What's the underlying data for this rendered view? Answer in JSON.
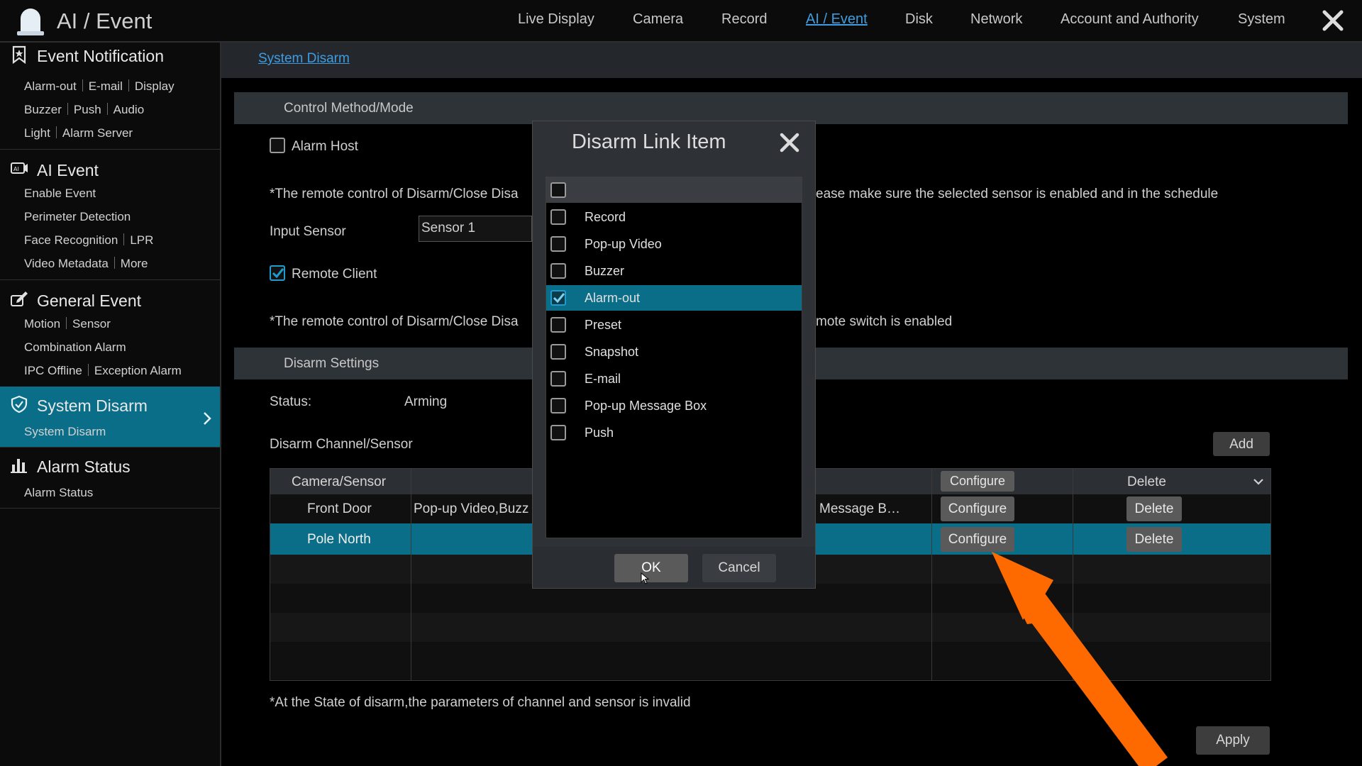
{
  "app": {
    "title": "AI / Event"
  },
  "nav": {
    "items": [
      "Live Display",
      "Camera",
      "Record",
      "AI / Event",
      "Disk",
      "Network",
      "Account and Authority",
      "System"
    ],
    "active": "AI / Event"
  },
  "sidebar": {
    "sections": [
      {
        "title": "Event Notification",
        "icon": "bookmark-star-icon",
        "rows": [
          [
            "Alarm-out",
            "E-mail",
            "Display"
          ],
          [
            "Buzzer",
            "Push",
            "Audio"
          ],
          [
            "Light",
            "Alarm Server"
          ]
        ]
      },
      {
        "title": "AI Event",
        "icon": "ai-camera-icon",
        "rows": [
          [
            "Enable Event"
          ],
          [
            "Perimeter Detection"
          ],
          [
            "Face Recognition",
            "LPR"
          ],
          [
            "Video Metadata",
            "More"
          ]
        ]
      },
      {
        "title": "General Event",
        "icon": "general-event-icon",
        "rows": [
          [
            "Motion",
            "Sensor"
          ],
          [
            "Combination Alarm"
          ],
          [
            "IPC Offline",
            "Exception Alarm"
          ]
        ]
      },
      {
        "title": "System Disarm",
        "icon": "shield-icon",
        "active": true,
        "rows": [
          [
            "System Disarm"
          ]
        ]
      },
      {
        "title": "Alarm Status",
        "icon": "bar-chart-icon",
        "rows": [
          [
            "Alarm Status"
          ]
        ]
      }
    ]
  },
  "page": {
    "breadcrumb": "System Disarm",
    "control_method": {
      "title": "Control Method/Mode",
      "alarm_host_label": "Alarm Host",
      "alarm_host_checked": false,
      "note1_left": "*The remote control of Disarm/Close Disa",
      "note1_right": "ease make sure the selected sensor is enabled and in the schedule",
      "input_sensor_label": "Input Sensor",
      "input_sensor_value": "Sensor 1",
      "remote_client_label": "Remote Client",
      "remote_client_checked": true,
      "note2_left": "*The remote control of Disarm/Close Disa",
      "note2_right": "mote switch is enabled"
    },
    "disarm_settings": {
      "title": "Disarm Settings",
      "status_label": "Status:",
      "status_value": "Arming",
      "channel_label": "Disarm Channel/Sensor",
      "add_label": "Add"
    },
    "table": {
      "headers": {
        "camera": "Camera/Sensor",
        "configure": "Configure",
        "delete": "Delete"
      },
      "rows": [
        {
          "name": "Front Door",
          "items_left": "Pop-up Video,Buzz",
          "items_right": "Message B…",
          "configure": "Configure",
          "delete": "Delete"
        },
        {
          "name": "Pole North",
          "items_left": "",
          "items_right": "",
          "configure": "Configure",
          "delete": "Delete",
          "selected": true
        }
      ]
    },
    "footer_note": "*At the State of disarm,the parameters of channel and sensor is invalid",
    "apply_label": "Apply"
  },
  "dialog": {
    "title": "Disarm Link Item",
    "items": [
      {
        "label": "Record",
        "checked": false
      },
      {
        "label": "Pop-up Video",
        "checked": false
      },
      {
        "label": "Buzzer",
        "checked": false
      },
      {
        "label": "Alarm-out",
        "checked": true
      },
      {
        "label": "Preset",
        "checked": false
      },
      {
        "label": "Snapshot",
        "checked": false
      },
      {
        "label": "E-mail",
        "checked": false
      },
      {
        "label": "Pop-up Message Box",
        "checked": false
      },
      {
        "label": "Push",
        "checked": false
      }
    ],
    "ok_label": "OK",
    "cancel_label": "Cancel"
  },
  "colors": {
    "accent": "#0b6e88",
    "link": "#3f9ce0",
    "annotation_arrow": "#ff6a00"
  }
}
